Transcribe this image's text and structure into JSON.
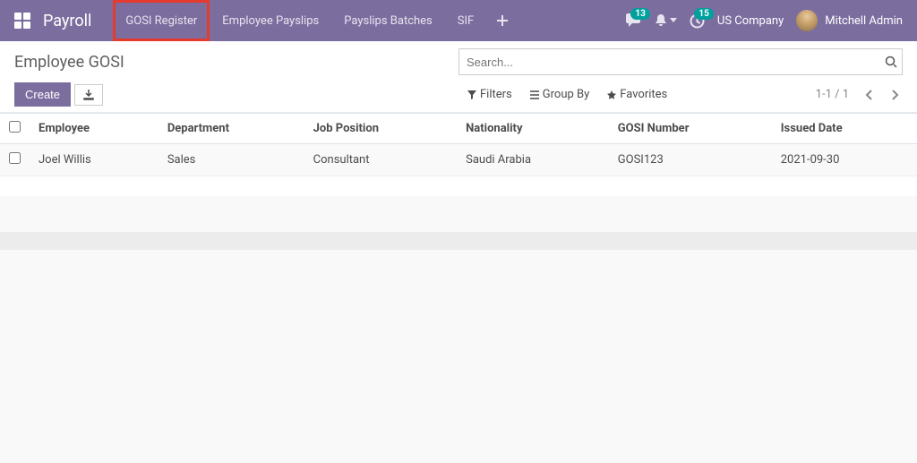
{
  "nav": {
    "app_title": "Payroll",
    "items": [
      {
        "label": "GOSI Register",
        "highlighted": true
      },
      {
        "label": "Employee Payslips"
      },
      {
        "label": "Payslips Batches"
      },
      {
        "label": "SIF"
      }
    ],
    "messages_badge": "13",
    "activities_badge": "15",
    "company": "US Company",
    "user": "Mitchell Admin"
  },
  "controls": {
    "breadcrumb": "Employee GOSI",
    "search_placeholder": "Search...",
    "create_label": "Create",
    "filters_label": "Filters",
    "group_by_label": "Group By",
    "favorites_label": "Favorites",
    "pager_text": "1-1 / 1"
  },
  "table": {
    "columns": [
      "Employee",
      "Department",
      "Job Position",
      "Nationality",
      "GOSI Number",
      "Issued Date"
    ],
    "rows": [
      {
        "employee": "Joel Willis",
        "department": "Sales",
        "job_position": "Consultant",
        "nationality": "Saudi Arabia",
        "gosi_number": "GOSI123",
        "issued_date": "2021-09-30"
      }
    ]
  }
}
